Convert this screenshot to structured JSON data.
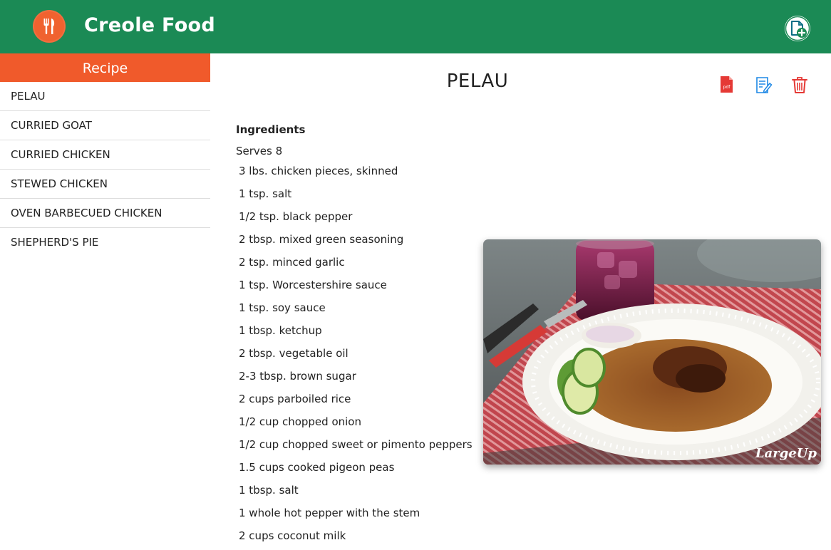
{
  "app": {
    "title": "Creole Food"
  },
  "sidebar": {
    "header": "Recipe",
    "items": [
      {
        "label": "PELAU"
      },
      {
        "label": "CURRIED GOAT"
      },
      {
        "label": "CURRIED CHICKEN"
      },
      {
        "label": "STEWED CHICKEN"
      },
      {
        "label": "OVEN BARBECUED CHICKEN"
      },
      {
        "label": "SHEPHERD'S PIE"
      }
    ]
  },
  "recipe": {
    "title": "PELAU",
    "ingredients_label": "Ingredients",
    "serves": "Serves 8",
    "ingredients": [
      "3 lbs. chicken pieces, skinned",
      "1 tsp. salt",
      "1/2 tsp. black pepper",
      "2 tbsp. mixed green seasoning",
      "2 tsp. minced garlic",
      "1 tsp. Worcestershire sauce",
      "1 tsp. soy sauce",
      "1 tbsp. ketchup",
      "2 tbsp. vegetable oil",
      "2-3 tbsp. brown sugar",
      "2 cups parboiled rice",
      "1/2 cup chopped onion",
      "1/2 cup chopped sweet or pimento peppers",
      "1.5 cups cooked pigeon peas",
      "1 tbsp. salt",
      "1 whole hot pepper with the stem",
      "2 cups coconut milk"
    ],
    "pdf_label": "pdf",
    "watermark": "LargeUp"
  },
  "icons": {
    "logo": "fork-knife-icon",
    "add": "add-document-icon",
    "pdf": "pdf-icon",
    "edit": "edit-icon",
    "delete": "trash-icon"
  },
  "colors": {
    "header": "#1b8a55",
    "accent": "#f05a2b",
    "pdf": "#e53935",
    "edit": "#1e88e5",
    "delete": "#e53935"
  }
}
